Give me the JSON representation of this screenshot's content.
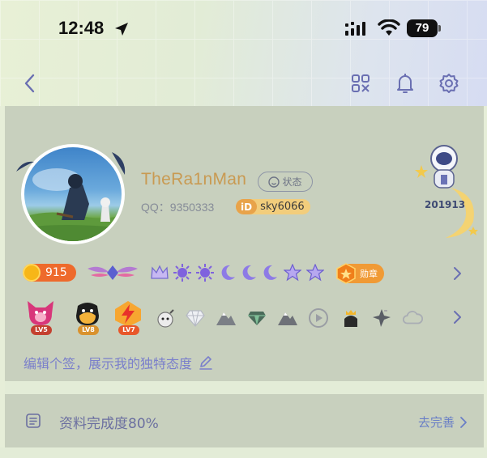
{
  "status_bar": {
    "time": "12:48",
    "battery": "79",
    "icons": [
      "location-arrow-icon",
      "signal-icon",
      "wifi-icon",
      "battery-icon"
    ]
  },
  "nav": {
    "icons": [
      "back-icon",
      "qr-code-icon",
      "bell-icon",
      "settings-icon"
    ]
  },
  "profile": {
    "nickname": "TheRa1nMan",
    "status_label": "状态",
    "qq_label": "QQ：9350333",
    "id_tag": "iD",
    "id_value": "sky6066",
    "likes": "201913"
  },
  "badges_row": {
    "coin_value": "915",
    "medal_label": "勋章",
    "icons": [
      "wing-badge-icon",
      "crown-icon",
      "sun-icon",
      "sun-icon",
      "moon-icon",
      "moon-icon",
      "moon-icon",
      "star-icon",
      "star-icon",
      "medal-icon",
      "chevron-right-icon"
    ]
  },
  "games_row": {
    "games": [
      {
        "level": "LV5",
        "color": "#d8367a"
      },
      {
        "level": "LV8",
        "color": "#1d1d1d"
      },
      {
        "level": "LV7",
        "color": "#f05a2a"
      }
    ],
    "icons": [
      "bomb-icon",
      "diamond-icon",
      "mountain-icon",
      "gem-icon",
      "mountain-icon",
      "play-icon",
      "crown-penguin-icon",
      "star-shard-icon",
      "cloud-icon",
      "chevron-right-icon"
    ]
  },
  "signature": "编辑个签，展示我的独特态度",
  "completion": {
    "label": "资料完成度80%",
    "action": "去完善"
  },
  "colors": {
    "card_bg": "#c8d0be",
    "name_gold": "#c99a52",
    "accent_purple": "#7a7fcb",
    "coin_orange": "#ee6a2c"
  }
}
